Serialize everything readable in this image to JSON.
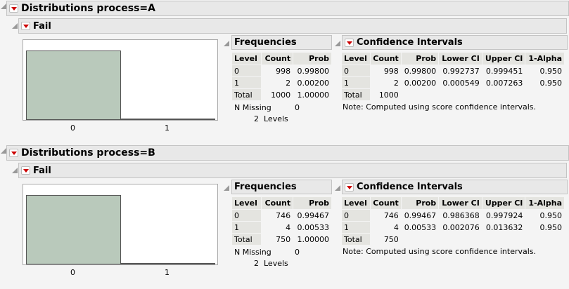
{
  "sections": [
    {
      "title": "Distributions process=A",
      "variable": "Fail",
      "chart": {
        "categories": [
          "0",
          "1"
        ],
        "counts": [
          998,
          2
        ]
      },
      "frequencies": {
        "title": "Frequencies",
        "headers": [
          "Level",
          "Count",
          "Prob"
        ],
        "rows": [
          [
            "0",
            "998",
            "0.99800"
          ],
          [
            "1",
            "2",
            "0.00200"
          ],
          [
            "Total",
            "1000",
            "1.00000"
          ]
        ],
        "n_missing_label": "N Missing",
        "n_missing": "0",
        "levels": "2  Levels"
      },
      "ci": {
        "title": "Confidence Intervals",
        "headers": [
          "Level",
          "Count",
          "Prob",
          "Lower CI",
          "Upper CI",
          "1-Alpha"
        ],
        "rows": [
          [
            "0",
            "998",
            "0.99800",
            "0.992737",
            "0.999451",
            "0.950"
          ],
          [
            "1",
            "2",
            "0.00200",
            "0.000549",
            "0.007263",
            "0.950"
          ],
          [
            "Total",
            "1000",
            "",
            "",
            "",
            ""
          ]
        ],
        "note": "Note: Computed using score confidence intervals."
      }
    },
    {
      "title": "Distributions process=B",
      "variable": "Fail",
      "chart": {
        "categories": [
          "0",
          "1"
        ],
        "counts": [
          746,
          4
        ]
      },
      "frequencies": {
        "title": "Frequencies",
        "headers": [
          "Level",
          "Count",
          "Prob"
        ],
        "rows": [
          [
            "0",
            "746",
            "0.99467"
          ],
          [
            "1",
            "4",
            "0.00533"
          ],
          [
            "Total",
            "750",
            "1.00000"
          ]
        ],
        "n_missing_label": "N Missing",
        "n_missing": "0",
        "levels": "2  Levels"
      },
      "ci": {
        "title": "Confidence Intervals",
        "headers": [
          "Level",
          "Count",
          "Prob",
          "Lower CI",
          "Upper CI",
          "1-Alpha"
        ],
        "rows": [
          [
            "0",
            "746",
            "0.99467",
            "0.986368",
            "0.997924",
            "0.950"
          ],
          [
            "1",
            "4",
            "0.00533",
            "0.002076",
            "0.013632",
            "0.950"
          ],
          [
            "Total",
            "750",
            "",
            "",
            "",
            ""
          ]
        ],
        "note": "Note: Computed using score confidence intervals."
      }
    }
  ],
  "colors": {
    "bar": "#b9c9bb",
    "menu_arrow": "#cc0000"
  }
}
